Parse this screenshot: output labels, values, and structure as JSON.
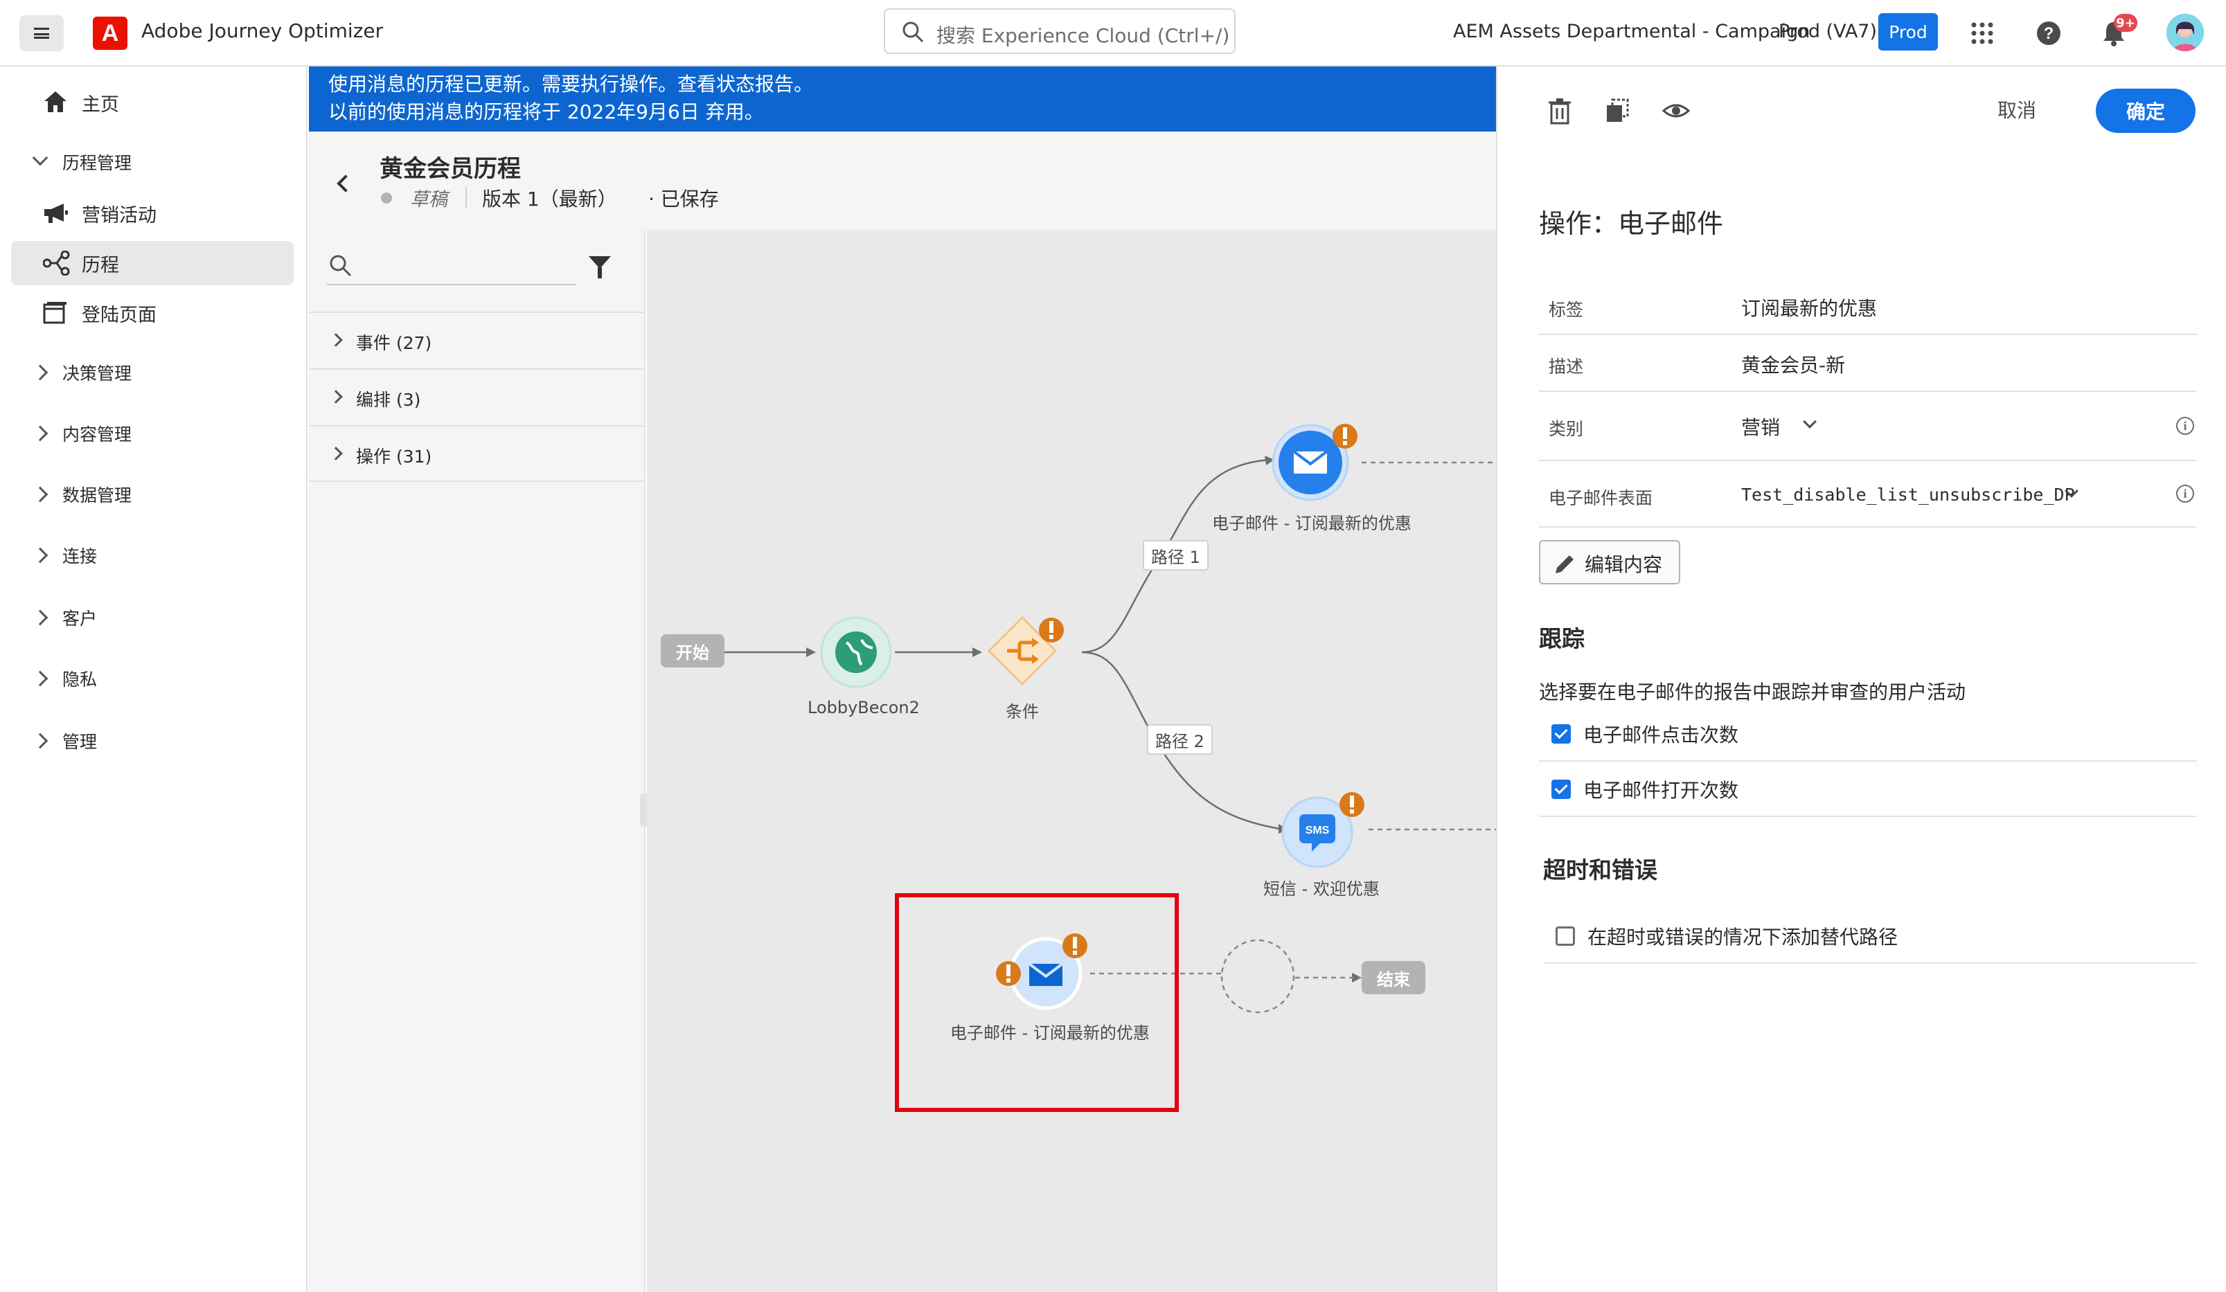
{
  "app": {
    "title": "Adobe Journey Optimizer",
    "logo_letter": "A"
  },
  "header": {
    "search_placeholder": "搜索 Experience Cloud (Ctrl+/)",
    "org_name": "AEM Assets Departmental - Campaign",
    "sandbox": "Prod (VA7)",
    "env_badge": "Prod",
    "notification_count": "9+",
    "icons": [
      "menu-icon",
      "apps-grid-icon",
      "help-icon",
      "bell-icon",
      "avatar"
    ]
  },
  "nav": {
    "home": "主页",
    "journey_mgmt": "历程管理",
    "campaigns": "营销活动",
    "journeys": "历程",
    "landing_pages": "登陆页面",
    "decision_mgmt": "决策管理",
    "content_mgmt": "内容管理",
    "data_mgmt": "数据管理",
    "connections": "连接",
    "customers": "客户",
    "privacy": "隐私",
    "admin": "管理"
  },
  "banner": {
    "line1": "使用消息的历程已更新。需要执行操作。查看状态报告。",
    "line2": "以前的使用消息的历程将于 2022年9月6日 弃用。"
  },
  "journey": {
    "name": "黄金会员历程",
    "status": "草稿",
    "version": "版本 1（最新）",
    "saved": "· 已保存"
  },
  "palette": {
    "rows": [
      {
        "label": "事件 (27)"
      },
      {
        "label": "编排 (3)"
      },
      {
        "label": "操作 (31)"
      }
    ]
  },
  "canvas": {
    "start": "开始",
    "event_node": "LobbyBecon2",
    "condition_node": "条件",
    "path1": "路径 1",
    "path2": "路径 2",
    "email_top": "电子邮件 - 订阅最新的优惠",
    "sms": "短信 - 欢迎优惠",
    "sms_badge": "SMS",
    "email_selected": "电子邮件 - 订阅最新的优惠",
    "end": "结束"
  },
  "panel": {
    "cancel": "取消",
    "confirm": "确定",
    "action_title": "操作：电子邮件",
    "label_key": "标签",
    "label_value": "订阅最新的优惠",
    "desc_key": "描述",
    "desc_value": "黄金会员-新",
    "category_key": "类别",
    "category_value": "营销",
    "surface_key": "电子邮件表面",
    "surface_value": "Test_disable_list_unsubscribe_DP",
    "edit_content": "编辑内容",
    "tracking_title": "跟踪",
    "tracking_desc": "选择要在电子邮件的报告中跟踪并审查的用户活动",
    "track_clicks": "电子邮件点击次数",
    "track_clicks_checked": true,
    "track_opens": "电子邮件打开次数",
    "track_opens_checked": true,
    "timeout_title": "超时和错误",
    "timeout_option": "在超时或错误的情况下添加替代路径",
    "timeout_checked": false
  },
  "colors": {
    "accent": "#1473e6",
    "banner": "#0d66d0",
    "warning": "#e68619",
    "highlight": "#e3000f",
    "event_green": "#2d9d78",
    "condition_orange": "#e68619"
  }
}
